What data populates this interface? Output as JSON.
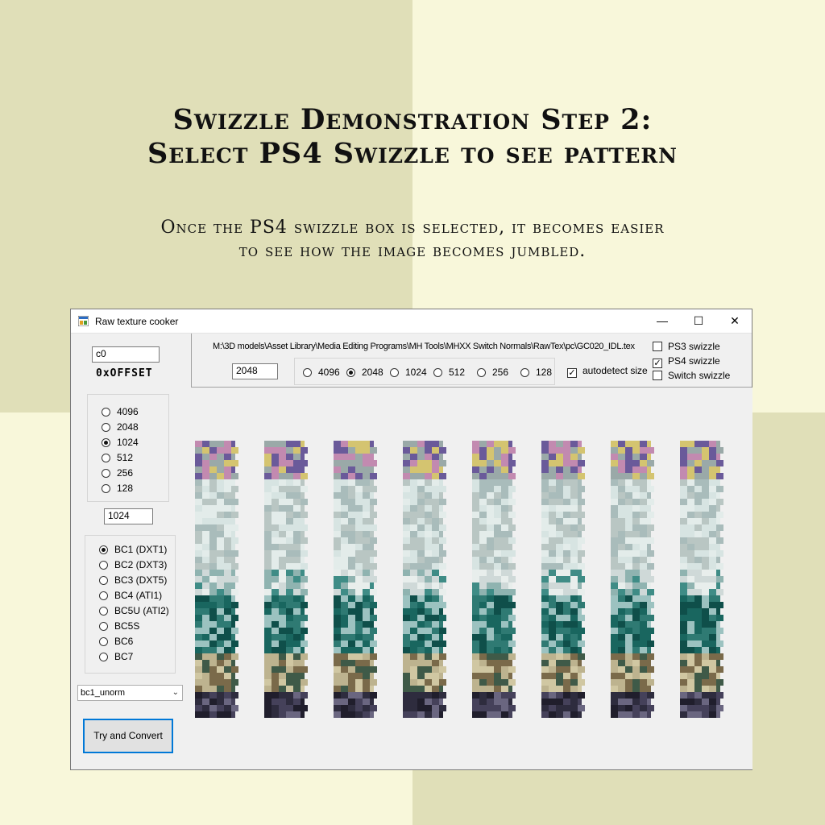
{
  "heading": {
    "title_line1": "Swizzle Demonstration Step 2:",
    "title_line2": "Select PS4 Swizzle to see pattern",
    "sub_line1": "Once the PS4 swizzle box is selected, it becomes easier",
    "sub_line2": "to see how the image becomes jumbled."
  },
  "window": {
    "title": "Raw texture cooker",
    "icon": "app-icon",
    "controls": {
      "minimize": "—",
      "maximize": "☐",
      "close": "✕"
    }
  },
  "left": {
    "offset_value": "c0",
    "offset_label": "0xOFFSET",
    "sizes": [
      {
        "label": "4096",
        "selected": false
      },
      {
        "label": "2048",
        "selected": false
      },
      {
        "label": "1024",
        "selected": true
      },
      {
        "label": "512",
        "selected": false
      },
      {
        "label": "256",
        "selected": false
      },
      {
        "label": "128",
        "selected": false
      }
    ],
    "width_value": "1024",
    "formats": [
      {
        "label": "BC1 (DXT1)",
        "selected": true
      },
      {
        "label": "BC2 (DXT3)",
        "selected": false
      },
      {
        "label": "BC3 (DXT5)",
        "selected": false
      },
      {
        "label": "BC4 (ATI1)",
        "selected": false
      },
      {
        "label": "BC5U (ATI2)",
        "selected": false
      },
      {
        "label": "BC5S",
        "selected": false
      },
      {
        "label": "BC6",
        "selected": false
      },
      {
        "label": "BC7",
        "selected": false
      }
    ],
    "format_select": "bc1_unorm",
    "convert_label": "Try and Convert"
  },
  "top": {
    "path": "M:\\3D models\\Asset Library\\Media Editing Programs\\MH Tools\\MHXX Switch Normals\\RawTex\\pc\\GC020_IDL.tex",
    "height_value": "2048",
    "sizes": [
      {
        "label": "4096",
        "selected": false
      },
      {
        "label": "2048",
        "selected": true
      },
      {
        "label": "1024",
        "selected": false
      },
      {
        "label": "512",
        "selected": false
      },
      {
        "label": "256",
        "selected": false
      },
      {
        "label": "128",
        "selected": false
      }
    ],
    "autodetect": {
      "label": "autodetect size",
      "checked": true
    },
    "ps3": {
      "label": "PS3 swizzle",
      "checked": false
    },
    "ps4": {
      "label": "PS4 swizzle",
      "checked": true
    },
    "switch": {
      "label": "Switch swizzle",
      "checked": false
    }
  },
  "preview": {
    "strip_count": 8,
    "colors": {
      "top": "#b9c6c3",
      "mid": "#e3ecea",
      "teal": "#19665f",
      "sand": "#bdb38f",
      "dark": "#2e2c3e"
    }
  }
}
